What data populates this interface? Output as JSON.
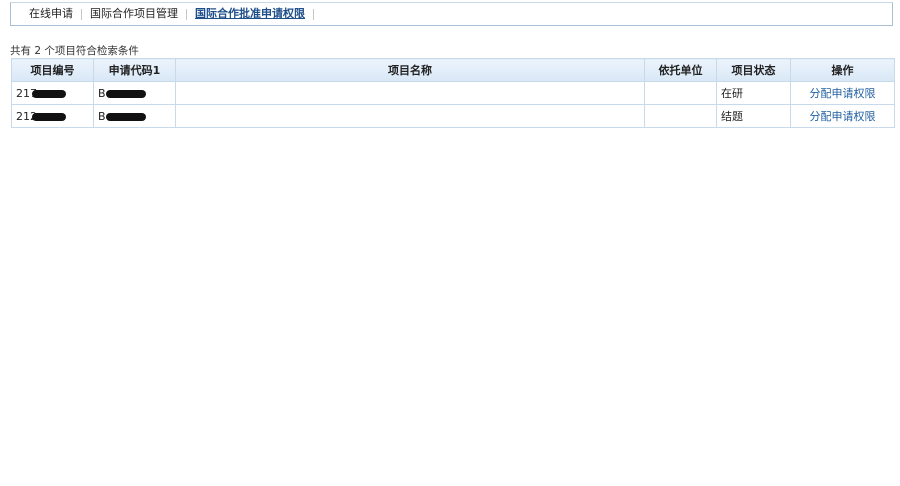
{
  "tabs": [
    {
      "label": "在线申请",
      "active": false
    },
    {
      "label": "国际合作项目管理",
      "active": false
    },
    {
      "label": "国际合作批准申请权限",
      "active": true
    }
  ],
  "summary": "共有 2 个项目符合检索条件",
  "table": {
    "headers": [
      "项目编号",
      "申请代码1",
      "项目名称",
      "依托单位",
      "项目状态",
      "操作"
    ],
    "rows": [
      {
        "id_prefix": "217",
        "code_prefix": "B",
        "name": "",
        "unit": "",
        "status": "在研",
        "action": "分配申请权限"
      },
      {
        "id_prefix": "212",
        "code_prefix": "B",
        "name": "",
        "unit": "",
        "status": "结题",
        "action": "分配申请权限"
      }
    ]
  }
}
